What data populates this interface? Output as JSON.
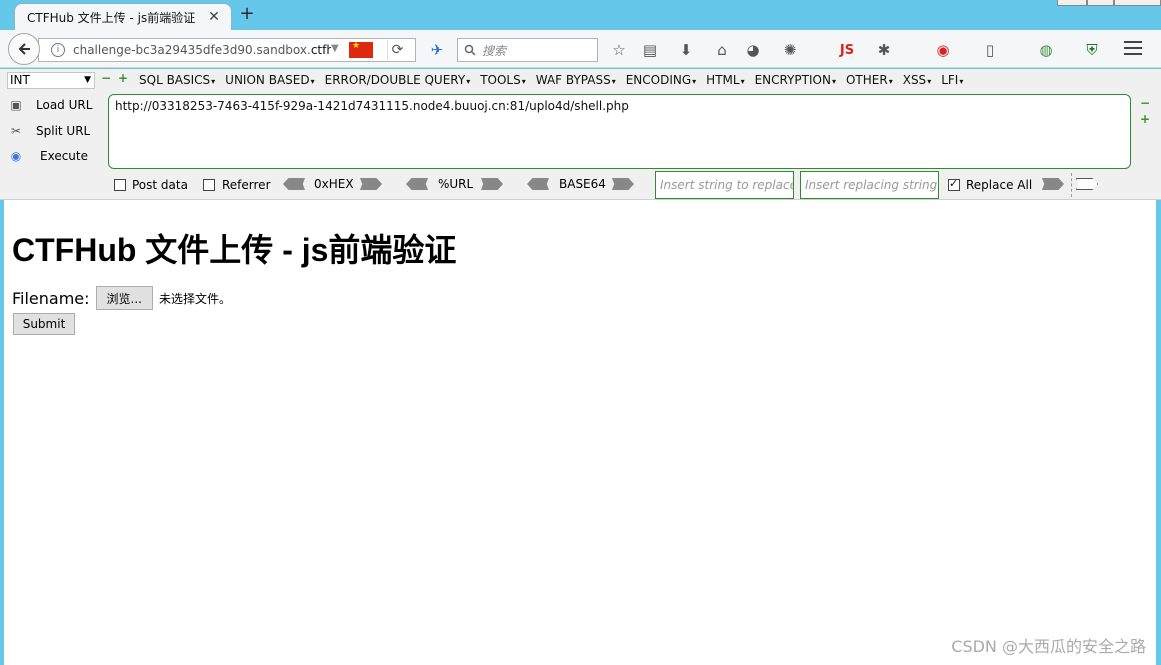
{
  "browser": {
    "tab": {
      "title": "CTFHub 文件上传 - js前端验证",
      "close_glyph": "✕"
    },
    "new_tab_glyph": "+",
    "url": {
      "prefix": "challenge-bc3a29435dfe3d90.sandbox.",
      "bold": "ctfh"
    },
    "search": {
      "placeholder": "搜索"
    },
    "toolbar_icons": [
      "star-icon",
      "reading-list-icon",
      "download-icon",
      "home-icon",
      "avatar-icon",
      "palette-icon",
      "js-icon",
      "bug-icon",
      "web-icon",
      "device-icon",
      "earth-icon",
      "shield-icon",
      "menu-icon"
    ],
    "js_label": "JS"
  },
  "hackbar": {
    "type_select": "INT",
    "menus": [
      "SQL BASICS",
      "UNION BASED",
      "ERROR/DOUBLE QUERY",
      "TOOLS",
      "WAF BYPASS",
      "ENCODING",
      "HTML",
      "ENCRYPTION",
      "OTHER",
      "XSS",
      "LFI"
    ],
    "side_buttons": {
      "load": "Load URL",
      "split": "Split URL",
      "execute": "Execute"
    },
    "url_value": "http://03318253-7463-415f-929a-1421d7431115.node4.buuoj.cn:81/uplo4d/shell.php",
    "post_data": "Post data",
    "referrer": "Referrer",
    "encoders": {
      "hex": "0xHEX",
      "url": "%URL",
      "base64": "BASE64"
    },
    "replace_placeholder": "Insert string to replace",
    "replacing_placeholder": "Insert replacing string",
    "replace_all": "Replace All",
    "post_data_checked": false,
    "referrer_checked": false,
    "replace_all_checked": true
  },
  "page": {
    "title": "CTFHub 文件上传 - js前端验证",
    "filename_label": "Filename:",
    "browse_label": "浏览...",
    "no_file_text": "未选择文件。",
    "submit_label": "Submit"
  },
  "watermark": "CSDN @大西瓜的安全之路",
  "colors": {
    "frame": "#66c9ea",
    "hackbar_border": "#2e8b2e",
    "js_red": "#d92323"
  }
}
